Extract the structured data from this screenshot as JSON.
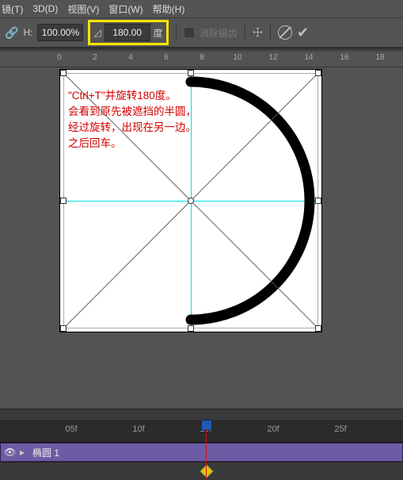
{
  "menu": {
    "items": [
      "镜(T)",
      "3D(D)",
      "视图(V)",
      "窗口(W)",
      "帮助(H)"
    ]
  },
  "options": {
    "h_label": "H:",
    "h_value": "100.00%",
    "angle_value": "180.00",
    "angle_unit": "度",
    "antialias": "消除锯齿"
  },
  "ruler_h": {
    "labels": [
      "0",
      "2",
      "4",
      "6",
      "8",
      "10",
      "12",
      "14",
      "16",
      "18"
    ]
  },
  "annotation": {
    "text": "\"Ctrl+T\"并旋转180度。\n会看到原先被遮挡的半圆，\n经过旋转，出现在另一边。\n之后回车。"
  },
  "timeline": {
    "frames": [
      "05f",
      "10f",
      "15f",
      "20f",
      "25f"
    ],
    "layer_name": "椭圆 1"
  }
}
